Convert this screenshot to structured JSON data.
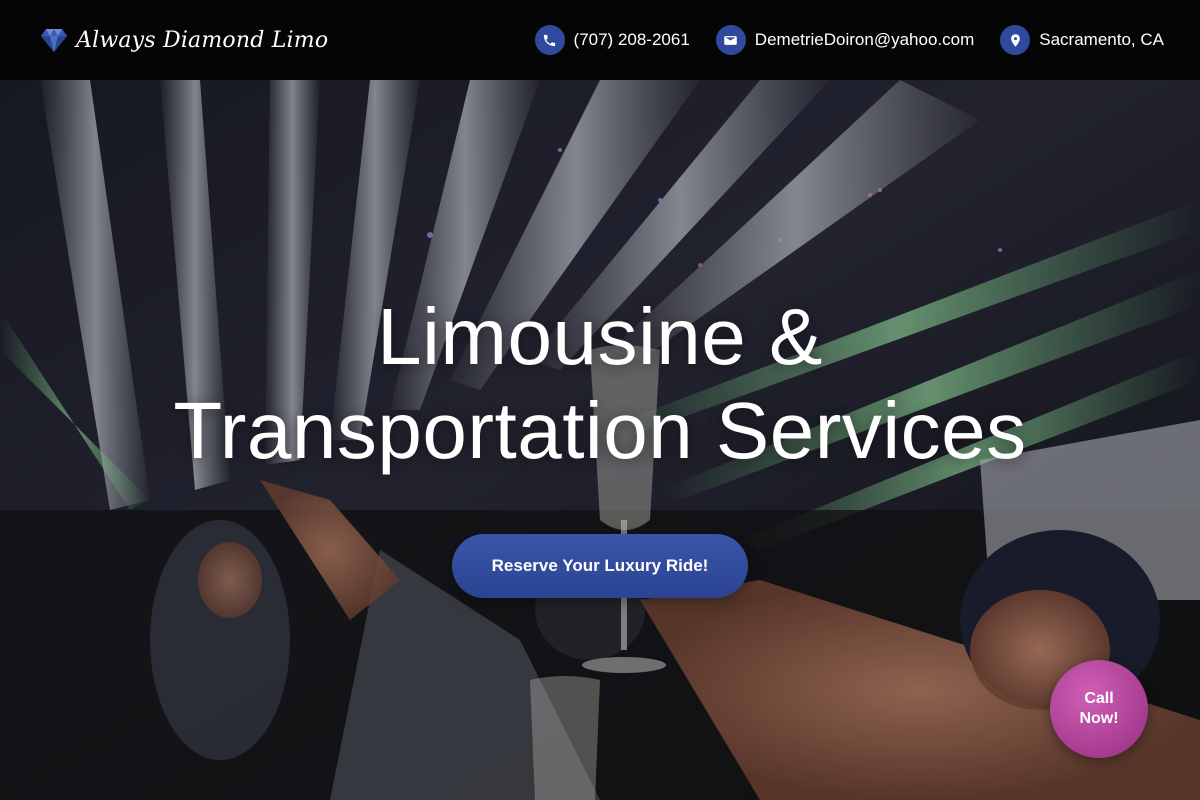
{
  "brand": {
    "name": "Always Diamond Limo",
    "logo_icon": "diamond-icon"
  },
  "contacts": {
    "phone": {
      "icon": "phone-icon",
      "text": "(707) 208-2061"
    },
    "email": {
      "icon": "mail-icon",
      "text": "DemetrieDoiron@yahoo.com"
    },
    "location": {
      "icon": "location-pin-icon",
      "text": "Sacramento, CA"
    }
  },
  "hero": {
    "title_line1": "Limousine &",
    "title_line2": "Transportation Services",
    "cta_label": "Reserve Your Luxury Ride!"
  },
  "call_button": {
    "label": "Call Now!"
  },
  "colors": {
    "header_bg": "#050505",
    "icon_circle": "#2f4a9c",
    "cta_bg": "#2f4a9c",
    "call_bg": "#a63c91"
  }
}
